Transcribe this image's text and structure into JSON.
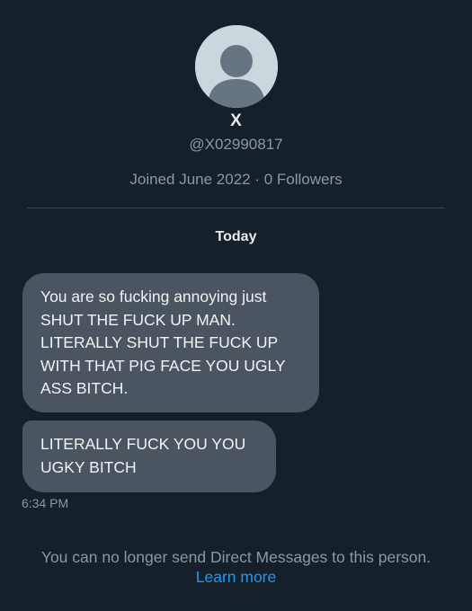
{
  "profile": {
    "display_name": "X",
    "handle": "@X02990817",
    "meta": "Joined June 2022 · 0 Followers",
    "avatar_icon": "default-avatar-icon"
  },
  "conversation": {
    "date_label": "Today",
    "messages": [
      {
        "text": "You are so fucking annoying just SHUT THE FUCK UP MAN. LITERALLY SHUT THE FUCK UP WITH THAT PIG FACE YOU UGLY ASS BITCH."
      },
      {
        "text": "LITERALLY FUCK YOU YOU UGKY BITCH"
      }
    ],
    "timestamp": "6:34 PM"
  },
  "footer": {
    "notice": "You can no longer send Direct Messages to this person.",
    "learn_more": "Learn more"
  },
  "colors": {
    "background": "#15202b",
    "bubble": "#4a5561",
    "link": "#1d9bf0",
    "muted": "#8b98a5"
  }
}
